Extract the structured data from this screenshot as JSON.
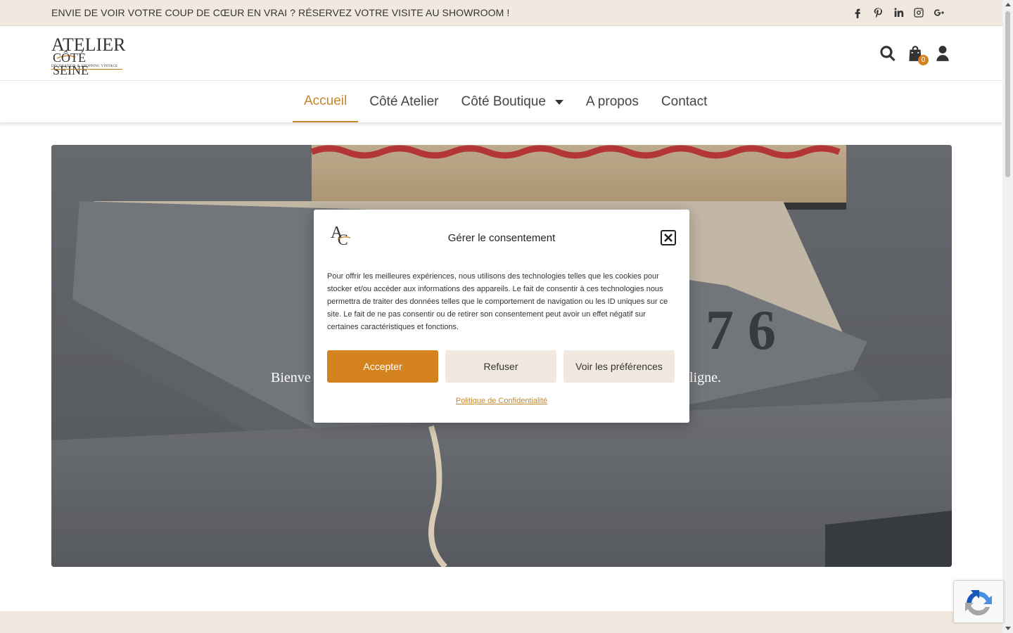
{
  "topbar": {
    "announcement": "ENVIE DE VOIR VOTRE COUP DE CŒUR EN VRAI ? RÉSERVEZ VOTRE VISITE AU SHOWROOM !",
    "social_icons": [
      "facebook-icon",
      "pinterest-icon",
      "linkedin-icon",
      "instagram-icon",
      "google-plus-icon"
    ]
  },
  "header": {
    "logo": {
      "line1": "ATELIER",
      "line2": "CÔTÉ SEINE",
      "tagline": "DÉCORATION & SHOPPING VINTAGE"
    },
    "icons": [
      "search-icon",
      "cart-icon",
      "user-icon"
    ],
    "cart_count": "0"
  },
  "nav": {
    "items": [
      {
        "label": "Accueil",
        "active": true
      },
      {
        "label": "Côté Atelier",
        "active": false
      },
      {
        "label": "Côté Boutique",
        "active": false,
        "has_dropdown": true
      },
      {
        "label": "A propos",
        "active": false
      },
      {
        "label": "Contact",
        "active": false
      }
    ]
  },
  "hero": {
    "text_left": "Bienve",
    "text_right": "n ligne."
  },
  "consent_modal": {
    "title": "Gérer le consentement",
    "body": "Pour offrir les meilleures expériences, nous utilisons des technologies telles que les cookies pour stocker et/ou accéder aux informations des appareils. Le fait de consentir à ces technologies nous permettra de traiter des données telles que le comportement de navigation ou les ID uniques sur ce site. Le fait de ne pas consentir ou de retirer son consentement peut avoir un effet négatif sur certaines caractéristiques et fonctions.",
    "accept_label": "Accepter",
    "refuse_label": "Refuser",
    "prefs_label": "Voir les préférences",
    "policy_link": "Politique de Confidentialité"
  },
  "colors": {
    "accent": "#d4831f",
    "beige": "#f1e9df",
    "nav_active": "#c6852b"
  }
}
